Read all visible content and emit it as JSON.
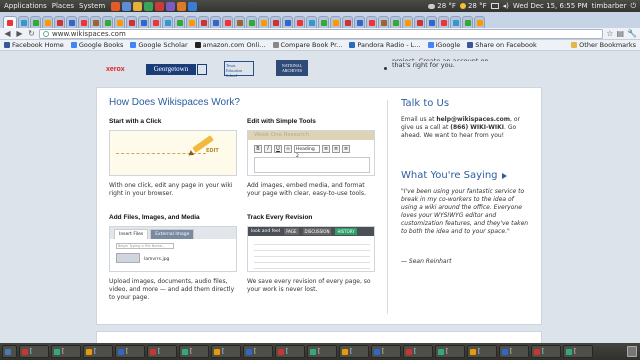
{
  "system_panel": {
    "menus": [
      "Applications",
      "Places",
      "System"
    ],
    "weather": [
      {
        "icon": "cloud-icon",
        "label": "28 °F"
      },
      {
        "icon": "sun-icon",
        "label": "28 °F"
      }
    ],
    "clock": "Wed Dec 15,  6:55 PM",
    "user": "timbarber",
    "launcher_colors": [
      "#e65a2a",
      "#5b8ed6",
      "#e4b23a",
      "#3aa35a",
      "#cc3a3a",
      "#7b5ac2",
      "#dd7a2a",
      "#3a7bd5"
    ]
  },
  "browser": {
    "tab_favicon_colors": [
      "#e33",
      "#39c",
      "#3a3",
      "#f90",
      "#c33",
      "#36c",
      "#e33",
      "#963",
      "#3a3",
      "#f90",
      "#c33",
      "#36c",
      "#e33",
      "#39c",
      "#3a3",
      "#f90",
      "#c33",
      "#36c",
      "#e33",
      "#963",
      "#3a3",
      "#f90",
      "#c33",
      "#36c",
      "#e33",
      "#39c",
      "#3a3",
      "#f90",
      "#c33",
      "#36c",
      "#e33",
      "#963",
      "#3a3",
      "#f90",
      "#c33",
      "#36c",
      "#e33",
      "#39c",
      "#3a3",
      "#f90"
    ],
    "url": "www.wikispaces.com",
    "bookmarks": [
      {
        "label": "Facebook  Home",
        "color": "#3b5998"
      },
      {
        "label": "Google Books",
        "color": "#4285f4"
      },
      {
        "label": "Google Scholar",
        "color": "#4285f4"
      },
      {
        "label": "amazon.com Onli...",
        "color": "#222"
      },
      {
        "label": "Compare Book Pr...",
        "color": "#888"
      },
      {
        "label": "Pandora Radio - L...",
        "color": "#2a6abb"
      },
      {
        "label": "iGoogle",
        "color": "#4285f4"
      },
      {
        "label": "Share on Facebook",
        "color": "#3b5998"
      }
    ],
    "other_bookmarks": "Other Bookmarks"
  },
  "page": {
    "logos": {
      "xerox": "xerox",
      "georgetown": "Georgetown",
      "tes": "Texas Education School",
      "archives": "NATIONAL ARCHIVES"
    },
    "cta_text_line1": "project. Create an account on Wikispaces.com and get the wiki",
    "cta_text_line2": "that's right for you.",
    "how_heading": "How Does Wikispaces Work?",
    "features": [
      {
        "title": "Start with a Click",
        "desc": "With one click, edit any page in your wiki right in your browser.",
        "edit_label": "EDIT"
      },
      {
        "title": "Edit with Simple Tools",
        "desc": "Add images, embed media, and format your page with clear, easy-to-use tools.",
        "header_text": "Week One Research",
        "heading_select": "Heading 2"
      },
      {
        "title": "Add Files, Images, and Media",
        "desc": "Upload images, documents, audio files, video, and more — and add them directly to your page.",
        "tab_insert": "Insert Files",
        "tab_external": "External Image",
        "search_placeholder": "Begin Typing a File Name...",
        "file_name": "lamvrrs.jpg"
      },
      {
        "title": "Track Every Revision",
        "desc": "We save every revision of every page, so your work is never lost.",
        "header_text": "look and feel",
        "tabs": [
          "PAGE",
          "DISCUSSION",
          "HISTORY"
        ]
      }
    ],
    "talk_heading": "Talk to Us",
    "talk_lead": "Email us at ",
    "talk_email": "help@wikispaces.com",
    "talk_mid": ", or give us a call at ",
    "talk_phone": "(866) WIKI-WIKI",
    "talk_tail": ". Go ahead. We want to hear from you!",
    "saying_heading": "What You're Saying",
    "quote": "\"I've been using your fantastic service to break in my co-workers to the idea of using a wiki around the office. Everyone loves your WYSIWYG editor and customization features, and they've taken to both the idea and to your space.\"",
    "quote_author": "— Sean Reinhart"
  },
  "taskbar": {
    "items": [
      {
        "label": "",
        "color": "#4a7ab5",
        "small": true
      },
      {
        "label": "[",
        "color": "#c33",
        "small": false
      },
      {
        "label": "[",
        "color": "#3a7",
        "small": false
      },
      {
        "label": "[",
        "color": "#e90",
        "small": false
      },
      {
        "label": "[",
        "color": "#36c",
        "small": false
      },
      {
        "label": "[",
        "color": "#c33",
        "small": false
      },
      {
        "label": "[",
        "color": "#3a7",
        "small": false
      },
      {
        "label": "[",
        "color": "#e90",
        "small": false
      },
      {
        "label": "[",
        "color": "#36c",
        "small": false
      },
      {
        "label": "[",
        "color": "#c33",
        "small": false
      },
      {
        "label": "[",
        "color": "#3a7",
        "small": false
      },
      {
        "label": "[",
        "color": "#e90",
        "small": false
      },
      {
        "label": "[",
        "color": "#36c",
        "small": false
      },
      {
        "label": "[",
        "color": "#c33",
        "small": false
      },
      {
        "label": "[",
        "color": "#3a7",
        "small": false
      },
      {
        "label": "[",
        "color": "#e90",
        "small": false
      },
      {
        "label": "[",
        "color": "#36c",
        "small": false
      },
      {
        "label": "[",
        "color": "#c33",
        "small": false
      },
      {
        "label": "[",
        "color": "#3a7",
        "small": false
      }
    ]
  }
}
